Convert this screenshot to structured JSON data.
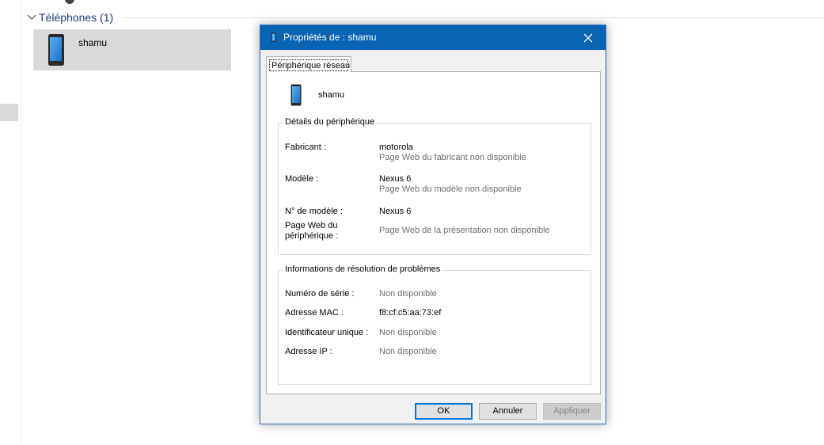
{
  "explorer": {
    "group_title": "Téléphones (1)",
    "device_name": "shamu"
  },
  "dialog": {
    "title": "Propriétés de : shamu",
    "tab_label": "Périphérique réseau",
    "device_name": "shamu",
    "details": {
      "title": "Détails du périphérique",
      "manufacturer_label": "Fabricant :",
      "manufacturer_value": "motorola",
      "manufacturer_web": "Page Web du fabricant non disponible",
      "model_label": "Modèle :",
      "model_value": "Nexus 6",
      "model_web": "Page Web du modèle non disponible",
      "model_number_label": "N° de modèle :",
      "model_number_value": "Nexus 6",
      "device_web_label_line1": "Page Web du",
      "device_web_label_line2": "périphérique :",
      "device_web_value": "Page Web de la présentation non disponible"
    },
    "troubleshooting": {
      "title": "Informations de résolution de problèmes",
      "serial_label": "Numéro de série :",
      "serial_value": "Non disponible",
      "mac_label": "Adresse MAC :",
      "mac_value": "f8:cf:c5:aa:73:ef",
      "uid_label": "Identificateur unique :",
      "uid_value": "Non disponible",
      "ip_label": "Adresse IP :",
      "ip_value": "Non disponible"
    },
    "buttons": {
      "ok": "OK",
      "cancel": "Annuler",
      "apply": "Appliquer"
    }
  },
  "icons": {
    "phone": "phone-icon",
    "close": "close-icon",
    "chevron": "chevron-down-icon"
  },
  "colors": {
    "titlebar": "#0a64b4",
    "selection": "#d9d9d9",
    "group_title": "#1e3d7a"
  }
}
